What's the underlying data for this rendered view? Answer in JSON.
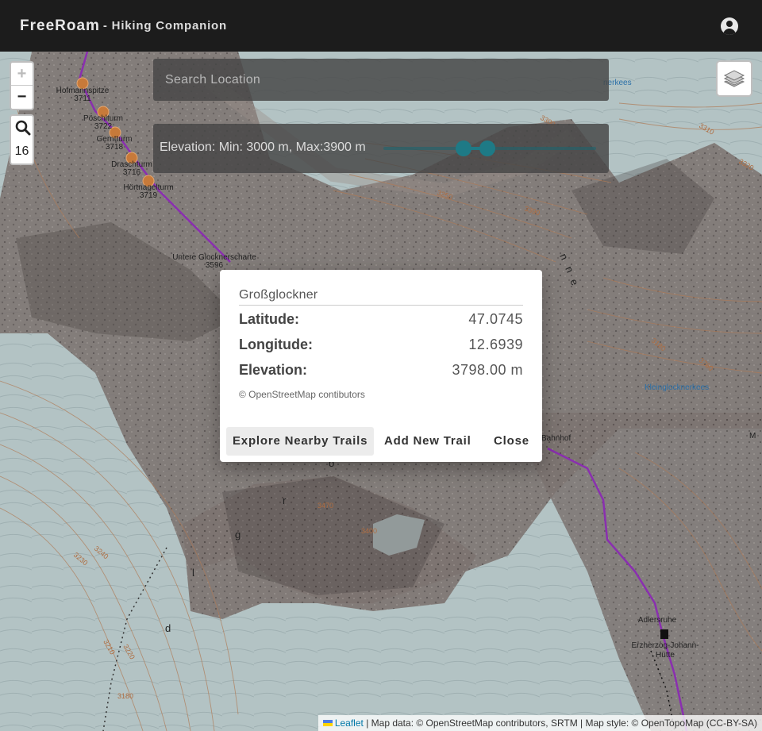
{
  "header": {
    "app_name": "FreeRoam",
    "subtitle": "- Hiking Companion",
    "account_icon": "account-circle-icon"
  },
  "map_controls": {
    "zoom_in": "+",
    "zoom_out": "−",
    "search_icon": "search-icon",
    "zoom_level": "16",
    "layers_icon": "layers-icon"
  },
  "search": {
    "placeholder": "Search Location",
    "value": ""
  },
  "elevation_filter": {
    "label": "Elevation: Min: 3000 m, Max:3900 m",
    "min": 3000,
    "max": 3900,
    "accent": "#1e7a86"
  },
  "map_labels": {
    "peaks": [
      {
        "name": "Hofmannspitze",
        "elev": "3711"
      },
      {
        "name": "Pöschlturm",
        "elev": "3722"
      },
      {
        "name": "Gerntturm",
        "elev": "3718"
      },
      {
        "name": "Draschturm",
        "elev": "3716"
      },
      {
        "name": "Hörtnagelturm",
        "elev": "3719"
      }
    ],
    "untere": {
      "name": "Untere Glocknerscharte",
      "elev": "3596"
    },
    "adlersruhe": "Adlersruhe",
    "hut_line1": "Erzherzog-Johann-",
    "hut_line2": "Hütte",
    "kleinglockner": "Kleinglocknerkees",
    "kees_top": "nerkees",
    "bahnhof": "Bahnhof",
    "m_label": "M",
    "contours": [
      "3240",
      "3230",
      "3210",
      "3220",
      "3180",
      "3300",
      "3310",
      "3320",
      "3470",
      "3400",
      "3390",
      "3250",
      "3180",
      "3760"
    ]
  },
  "popup": {
    "title": "Großglockner",
    "rows": [
      {
        "key": "Latitude:",
        "value": "47.0745"
      },
      {
        "key": "Longitude:",
        "value": "12.6939"
      },
      {
        "key": "Elevation:",
        "value": "3798.00 m"
      }
    ],
    "credit": "© OpenStreetMap contibutors",
    "buttons": {
      "explore": "Explore Nearby Trails",
      "add": "Add New Trail",
      "close": "Close"
    }
  },
  "attribution": {
    "leaflet": "Leaflet",
    "text": "| Map data: © OpenStreetMap contributors, SRTM | Map style: © OpenTopoMap (CC-BY-SA)"
  }
}
